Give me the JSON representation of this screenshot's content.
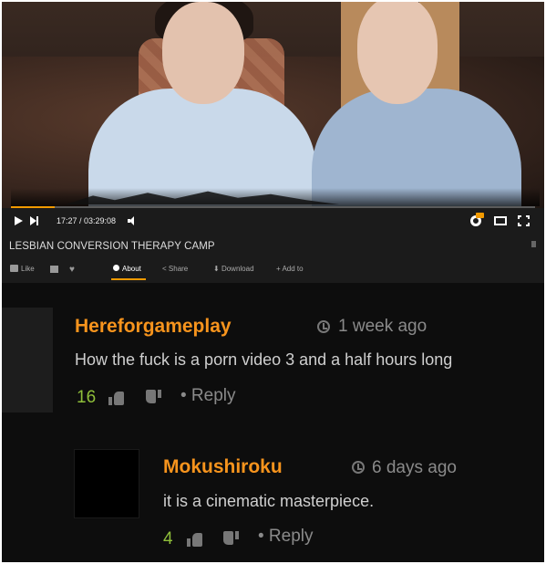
{
  "player": {
    "time_display": "17:27 / 03:29:08",
    "progress": 0.083,
    "accent_color": "#f29a00"
  },
  "video": {
    "title": "LESBIAN CONVERSION THERAPY CAMP",
    "actions": {
      "like": "Like",
      "about": "About",
      "share": "Share",
      "download": "Download",
      "add_to": "Add to"
    }
  },
  "comments": [
    {
      "username": "Hereforgameplay",
      "time_ago": "1 week ago",
      "text": "How the fuck is a porn video 3 and a half hours long",
      "votes": "16",
      "reply_label": "• Reply"
    },
    {
      "username": "Mokushiroku",
      "time_ago": "6 days ago",
      "text": "it is a cinematic masterpiece.",
      "votes": "4",
      "reply_label": "• Reply"
    }
  ],
  "colors": {
    "username": "#f7941d",
    "votes": "#8fbf3a",
    "comments_bg": "#0d0d0d"
  }
}
